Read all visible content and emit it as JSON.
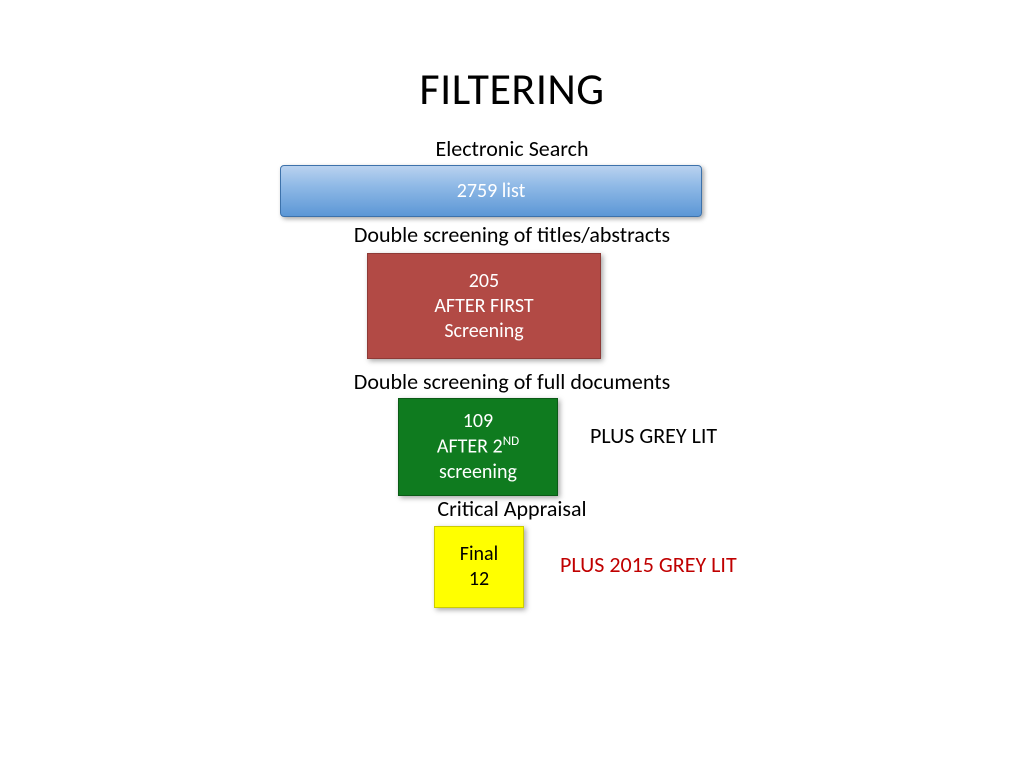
{
  "title": "FILTERING",
  "steps": {
    "s1": {
      "label": "Electronic Search",
      "box_text": "2759 list"
    },
    "s2": {
      "label": "Double screening of titles/abstracts",
      "box_l1": "205",
      "box_l2": "AFTER FIRST",
      "box_l3": "Screening"
    },
    "s3": {
      "label": "Double screening of full documents",
      "box_l1": "109",
      "box_l2_pre": "AFTER 2",
      "box_l2_sup": "ND",
      "box_l3": "screening",
      "side_note": "PLUS GREY LIT"
    },
    "s4": {
      "label": "Critical Appraisal",
      "box_l1": "Final",
      "box_l2": "12",
      "side_note": "PLUS 2015 GREY LIT"
    }
  }
}
